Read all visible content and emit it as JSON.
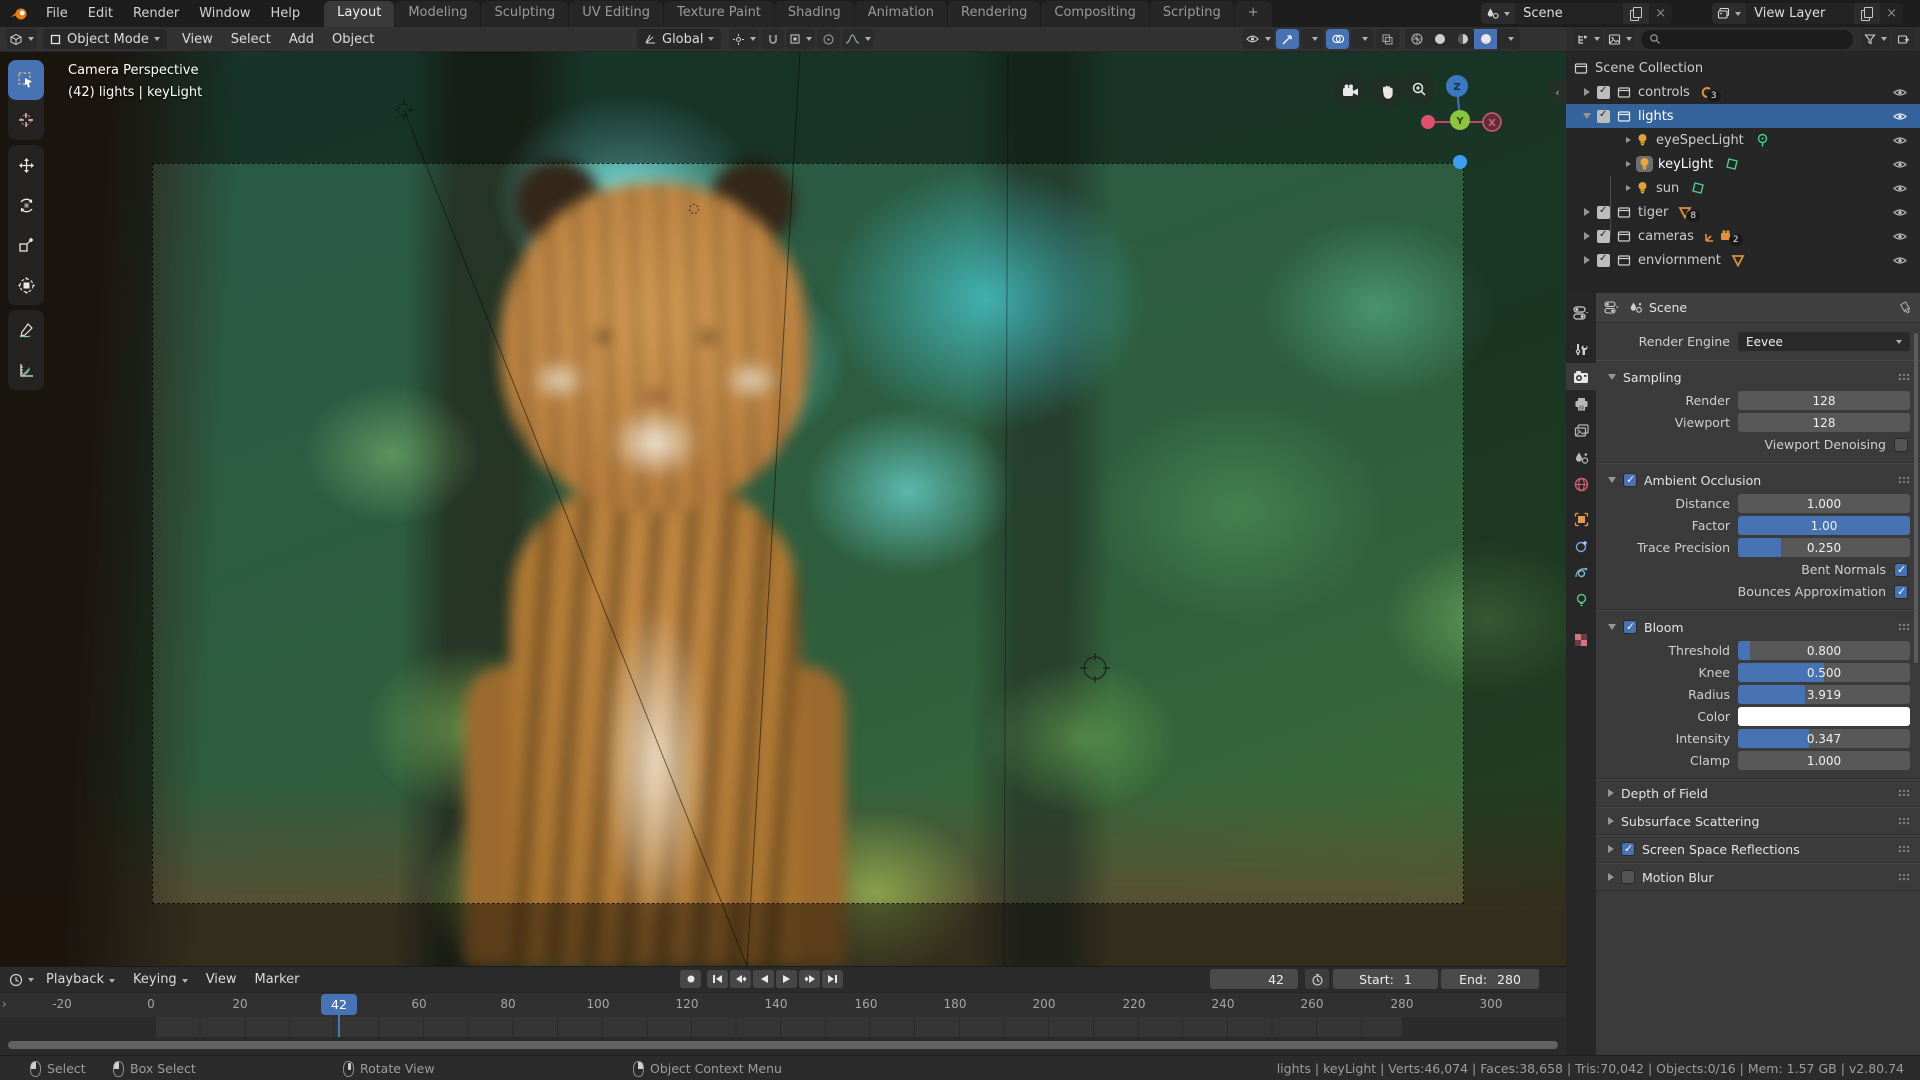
{
  "colors": {
    "accent": "#4772b3",
    "selection": "#35639c",
    "axis_x": "#e0506c",
    "axis_y": "#8bc53f",
    "axis_z": "#3b78bf",
    "light_icon": "#e0a03c",
    "data_icon_green": "#44cf8c"
  },
  "topbar": {
    "menus": [
      "File",
      "Edit",
      "Render",
      "Window",
      "Help"
    ],
    "tabs": [
      "Layout",
      "Modeling",
      "Sculpting",
      "UV Editing",
      "Texture Paint",
      "Shading",
      "Animation",
      "Rendering",
      "Compositing",
      "Scripting",
      "+"
    ],
    "active_tab": "Layout",
    "scene_selector": {
      "value": "Scene"
    },
    "view_layer_selector": {
      "value": "View Layer"
    }
  },
  "viewport_header": {
    "mode": "Object Mode",
    "menus": [
      "View",
      "Select",
      "Add",
      "Object"
    ],
    "orientation": "Global"
  },
  "viewport": {
    "overlay": {
      "line1": "Camera Perspective",
      "line2": "(42) lights | keyLight"
    },
    "gizmo": {
      "z": "Z",
      "y": "Y",
      "x": "X"
    }
  },
  "outliner": {
    "root": "Scene Collection",
    "items": [
      {
        "label": "controls",
        "badge": "3"
      },
      {
        "label": "lights"
      },
      {
        "label": "eyeSpecLight"
      },
      {
        "label": "keyLight"
      },
      {
        "label": "sun"
      },
      {
        "label": "tiger",
        "badge": "8"
      },
      {
        "label": "cameras",
        "badge": "2"
      },
      {
        "label": "enviornment"
      }
    ]
  },
  "properties": {
    "breadcrumb": "Scene",
    "render_engine": {
      "label": "Render Engine",
      "value": "Eevee"
    },
    "sampling": {
      "title": "Sampling",
      "render": {
        "label": "Render",
        "value": "128"
      },
      "viewport": {
        "label": "Viewport",
        "value": "128"
      },
      "denoising": {
        "label": "Viewport Denoising",
        "checked": false
      }
    },
    "ao": {
      "title": "Ambient Occlusion",
      "checked": true,
      "distance": {
        "label": "Distance",
        "value": "1.000"
      },
      "factor": {
        "label": "Factor",
        "value": "1.00"
      },
      "trace": {
        "label": "Trace Precision",
        "value": "0.250"
      },
      "bent": {
        "label": "Bent Normals",
        "checked": true
      },
      "bounces": {
        "label": "Bounces Approximation",
        "checked": true
      }
    },
    "bloom": {
      "title": "Bloom",
      "checked": true,
      "threshold": {
        "label": "Threshold",
        "value": "0.800"
      },
      "knee": {
        "label": "Knee",
        "value": "0.500"
      },
      "radius": {
        "label": "Radius",
        "value": "3.919"
      },
      "color": {
        "label": "Color",
        "value": "#ffffff"
      },
      "intensity": {
        "label": "Intensity",
        "value": "0.347"
      },
      "clamp": {
        "label": "Clamp",
        "value": "1.000"
      }
    },
    "collapsed": [
      {
        "title": "Depth of Field"
      },
      {
        "title": "Subsurface Scattering"
      },
      {
        "title": "Screen Space Reflections",
        "checked": true
      },
      {
        "title": "Motion Blur",
        "checked": false
      }
    ]
  },
  "timeline": {
    "menus": [
      "Playback",
      "Keying",
      "View",
      "Marker"
    ],
    "current_frame": "42",
    "start_label": "Start:",
    "start_value": "1",
    "end_label": "End:",
    "end_value": "280",
    "ticks": [
      "-20",
      "0",
      "20",
      "60",
      "80",
      "100",
      "120",
      "140",
      "160",
      "180",
      "200",
      "220",
      "240",
      "260",
      "280",
      "300"
    ]
  },
  "statusbar": {
    "hints": [
      {
        "label": "Select"
      },
      {
        "label": "Box Select"
      },
      {
        "label": "Rotate View"
      },
      {
        "label": "Object Context Menu"
      }
    ],
    "stats": "lights | keyLight | Verts:46,074 | Faces:38,658 | Tris:70,042 | Objects:0/16 | Mem: 1.57 GB | v2.80.74"
  }
}
